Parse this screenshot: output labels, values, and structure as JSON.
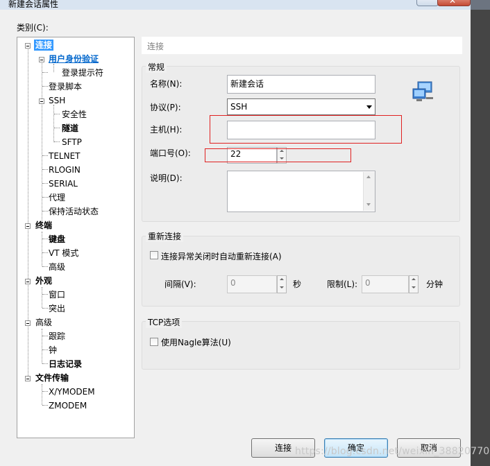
{
  "window": {
    "title": "新建会话属性"
  },
  "category_label": "类别(C):",
  "tree": {
    "connection": "连接",
    "user_auth": "用户身份验证",
    "login_prompt": "登录提示符",
    "login_script": "登录脚本",
    "ssh": "SSH",
    "security": "安全性",
    "tunnel": "隧道",
    "sftp": "SFTP",
    "telnet": "TELNET",
    "rlogin": "RLOGIN",
    "serial": "SERIAL",
    "proxy": "代理",
    "keepalive": "保持活动状态",
    "terminal": "终端",
    "keyboard": "键盘",
    "vt_mode": "VT 模式",
    "advanced1": "高级",
    "appearance": "外观",
    "window": "窗口",
    "highlight": "突出",
    "advanced2": "高级",
    "trace": "跟踪",
    "bell": "钟",
    "logging": "日志记录",
    "file_transfer": "文件传输",
    "xymodem": "X/YMODEM",
    "zmodem": "ZMODEM"
  },
  "section_header": "连接",
  "general": {
    "title": "常规",
    "name_label": "名称(N):",
    "name_value": "新建会话",
    "protocol_label": "协议(P):",
    "protocol_value": "SSH",
    "host_label": "主机(H):",
    "host_value": "",
    "port_label": "端口号(O):",
    "port_value": "22",
    "desc_label": "说明(D):",
    "desc_value": ""
  },
  "reconnect": {
    "title": "重新连接",
    "auto_label": "连接异常关闭时自动重新连接(A)",
    "interval_label": "间隔(V):",
    "interval_value": "0",
    "sec_label": "秒",
    "limit_label": "限制(L):",
    "limit_value": "0",
    "min_label": "分钟"
  },
  "tcp": {
    "title": "TCP选项",
    "nagle_label": "使用Nagle算法(U)"
  },
  "buttons": {
    "connect": "连接",
    "ok": "确定",
    "cancel": "取消"
  },
  "watermark": "https://blog.csdn.net/weixin_38820770"
}
